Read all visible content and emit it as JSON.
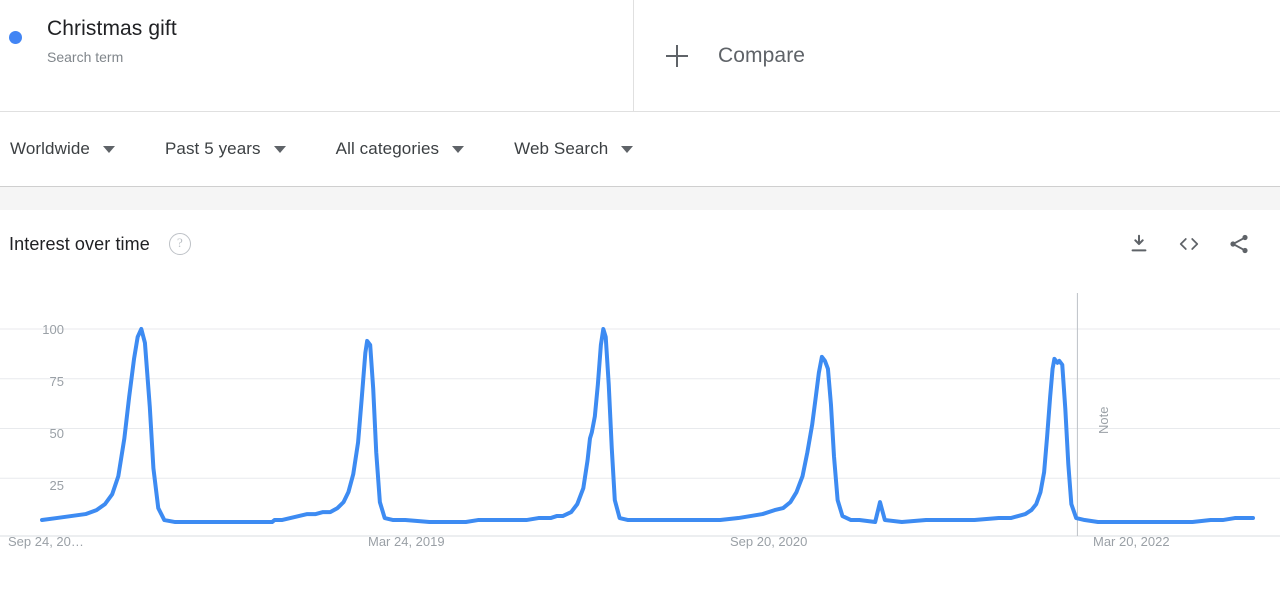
{
  "header": {
    "term": {
      "title": "Christmas gift",
      "subtitle": "Search term",
      "dot_color": "#4285f4"
    },
    "compare": {
      "label": "Compare",
      "icon": "plus-icon"
    }
  },
  "filters": [
    {
      "label": "Worldwide",
      "name": "location"
    },
    {
      "label": "Past 5 years",
      "name": "time-range"
    },
    {
      "label": "All categories",
      "name": "category"
    },
    {
      "label": "Web Search",
      "name": "search-type"
    }
  ],
  "card": {
    "title": "Interest over time",
    "help_icon": "?",
    "actions": [
      {
        "name": "download-icon",
        "label": "Download"
      },
      {
        "name": "embed-icon",
        "label": "Embed"
      },
      {
        "name": "share-icon",
        "label": "Share"
      }
    ]
  },
  "chart_data": {
    "type": "line",
    "title": "Interest over time",
    "xlabel": "",
    "ylabel": "",
    "ylim": [
      0,
      100
    ],
    "grid": true,
    "legend": false,
    "series_color": "#3d8bf2",
    "ytick_labels": [
      "100",
      "75",
      "50",
      "25"
    ],
    "ytick_values": [
      100,
      75,
      50,
      25
    ],
    "xtick_labels": [
      "Sep 24, 20…",
      "Mar 24, 2019",
      "Sep 20, 2020",
      "Mar 20, 2022"
    ],
    "annotations": [
      {
        "label": "Note",
        "x_fraction": 0.855
      }
    ],
    "series": [
      {
        "name": "Christmas gift",
        "points": [
          [
            0.0,
            4
          ],
          [
            0.012,
            5
          ],
          [
            0.024,
            6
          ],
          [
            0.036,
            7
          ],
          [
            0.045,
            9
          ],
          [
            0.052,
            12
          ],
          [
            0.058,
            17
          ],
          [
            0.063,
            26
          ],
          [
            0.068,
            45
          ],
          [
            0.072,
            66
          ],
          [
            0.076,
            85
          ],
          [
            0.079,
            96
          ],
          [
            0.082,
            100
          ],
          [
            0.085,
            93
          ],
          [
            0.089,
            61
          ],
          [
            0.092,
            30
          ],
          [
            0.096,
            10
          ],
          [
            0.101,
            4
          ],
          [
            0.11,
            3
          ],
          [
            0.13,
            3
          ],
          [
            0.16,
            3
          ],
          [
            0.19,
            3
          ],
          [
            0.192,
            4
          ],
          [
            0.198,
            4
          ],
          [
            0.205,
            5
          ],
          [
            0.212,
            6
          ],
          [
            0.219,
            7
          ],
          [
            0.226,
            7
          ],
          [
            0.232,
            8
          ],
          [
            0.238,
            8
          ],
          [
            0.244,
            10
          ],
          [
            0.249,
            13
          ],
          [
            0.253,
            18
          ],
          [
            0.257,
            27
          ],
          [
            0.261,
            43
          ],
          [
            0.264,
            65
          ],
          [
            0.267,
            88
          ],
          [
            0.2685,
            94
          ],
          [
            0.271,
            92
          ],
          [
            0.2735,
            70
          ],
          [
            0.276,
            38
          ],
          [
            0.279,
            13
          ],
          [
            0.283,
            5
          ],
          [
            0.29,
            4
          ],
          [
            0.3,
            4
          ],
          [
            0.32,
            3
          ],
          [
            0.35,
            3
          ],
          [
            0.36,
            4
          ],
          [
            0.37,
            4
          ],
          [
            0.385,
            4
          ],
          [
            0.4,
            4
          ],
          [
            0.41,
            5
          ],
          [
            0.42,
            5
          ],
          [
            0.425,
            6
          ],
          [
            0.43,
            6
          ],
          [
            0.437,
            8
          ],
          [
            0.442,
            12
          ],
          [
            0.447,
            20
          ],
          [
            0.4505,
            34
          ],
          [
            0.4525,
            45
          ],
          [
            0.454,
            48
          ],
          [
            0.4565,
            56
          ],
          [
            0.459,
            72
          ],
          [
            0.4615,
            92
          ],
          [
            0.4635,
            100
          ],
          [
            0.4655,
            96
          ],
          [
            0.468,
            72
          ],
          [
            0.4705,
            40
          ],
          [
            0.473,
            14
          ],
          [
            0.477,
            5
          ],
          [
            0.484,
            4
          ],
          [
            0.5,
            4
          ],
          [
            0.53,
            4
          ],
          [
            0.56,
            4
          ],
          [
            0.575,
            5
          ],
          [
            0.585,
            6
          ],
          [
            0.595,
            7
          ],
          [
            0.605,
            9
          ],
          [
            0.612,
            10
          ],
          [
            0.618,
            13
          ],
          [
            0.623,
            18
          ],
          [
            0.628,
            26
          ],
          [
            0.632,
            38
          ],
          [
            0.636,
            52
          ],
          [
            0.639,
            66
          ],
          [
            0.6415,
            78
          ],
          [
            0.644,
            86
          ],
          [
            0.6465,
            84
          ],
          [
            0.649,
            80
          ],
          [
            0.6515,
            62
          ],
          [
            0.654,
            36
          ],
          [
            0.657,
            14
          ],
          [
            0.661,
            6
          ],
          [
            0.668,
            4
          ],
          [
            0.675,
            4
          ],
          [
            0.688,
            3
          ],
          [
            0.692,
            13
          ],
          [
            0.696,
            4
          ],
          [
            0.71,
            3
          ],
          [
            0.73,
            4
          ],
          [
            0.75,
            4
          ],
          [
            0.77,
            4
          ],
          [
            0.79,
            5
          ],
          [
            0.8,
            5
          ],
          [
            0.806,
            6
          ],
          [
            0.812,
            7
          ],
          [
            0.817,
            9
          ],
          [
            0.821,
            12
          ],
          [
            0.8245,
            18
          ],
          [
            0.8275,
            28
          ],
          [
            0.83,
            46
          ],
          [
            0.8325,
            66
          ],
          [
            0.8345,
            80
          ],
          [
            0.836,
            85
          ],
          [
            0.8385,
            83
          ],
          [
            0.84,
            84
          ],
          [
            0.8425,
            82
          ],
          [
            0.845,
            60
          ],
          [
            0.8475,
            32
          ],
          [
            0.85,
            12
          ],
          [
            0.854,
            5
          ],
          [
            0.861,
            4
          ],
          [
            0.872,
            3
          ],
          [
            0.89,
            3
          ],
          [
            0.92,
            3
          ],
          [
            0.95,
            3
          ],
          [
            0.965,
            4
          ],
          [
            0.975,
            4
          ],
          [
            0.985,
            5
          ],
          [
            1.0,
            5
          ]
        ]
      }
    ]
  }
}
